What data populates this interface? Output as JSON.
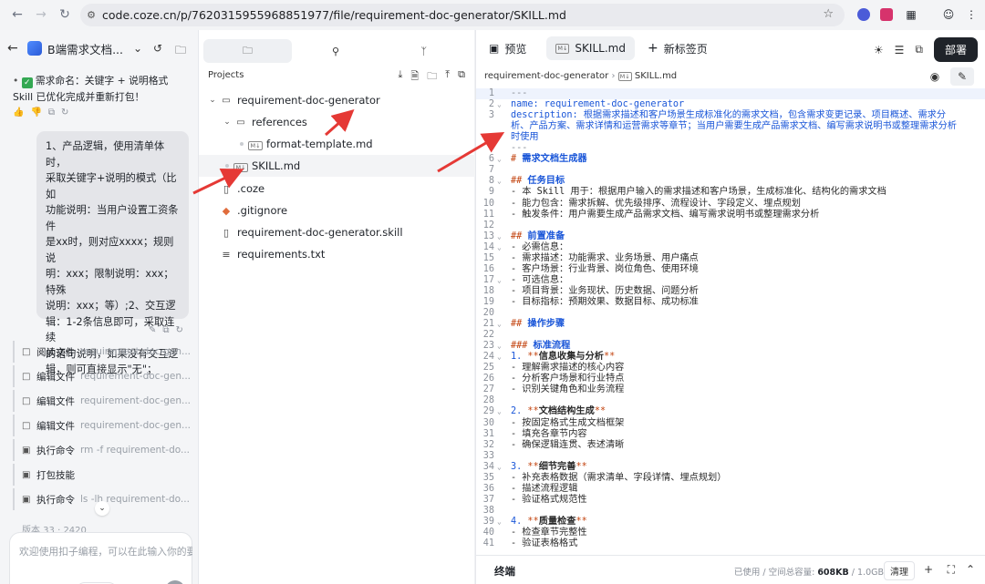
{
  "browser": {
    "url": "code.coze.cn/p/7620315955968851977/file/requirement-doc-generator/SKILL.md",
    "icons": [
      "back-icon",
      "forward-icon",
      "reload-icon",
      "site-info-icon",
      "star-icon",
      "extension-icon",
      "profile-icon",
      "menu-icon"
    ]
  },
  "chat": {
    "project_name": "B端需求文档...",
    "messages": {
      "line1": "需求命名：关键字 + 说明格式",
      "line2": "Skill 已优化完成并重新打包！"
    },
    "user_bubble": [
      "1、产品逻辑，使用清单体时，",
      "采取关键字+说明的模式（比如",
      "功能说明：当用户设置工资条件",
      "是xx时，则对应xxxx；规则说",
      "明：xxx；限制说明：xxx；特殊",
      "说明：xxx；等）;2、交互逻",
      "辑：1-2条信息即可，采取连续",
      "的语句说明，如果没有交互逻",
      "辑，则可直接显示\"无\"；"
    ],
    "tool_calls": [
      {
        "label": "阅读文件",
        "arg": "requirement-doc-gen...",
        "icon": "file-icon"
      },
      {
        "label": "编辑文件",
        "arg": "requirement-doc-gen...",
        "icon": "file-icon"
      },
      {
        "label": "编辑文件",
        "arg": "requirement-doc-gen...",
        "icon": "file-icon"
      },
      {
        "label": "编辑文件",
        "arg": "requirement-doc-gen...",
        "icon": "file-icon"
      },
      {
        "label": "执行命令",
        "arg": "rm -f requirement-do...",
        "icon": "terminal-icon"
      },
      {
        "label": "打包技能",
        "arg": "",
        "icon": "terminal-icon"
      },
      {
        "label": "执行命令",
        "arg": "ls -lh requirement-do...",
        "icon": "terminal-icon"
      }
    ],
    "peek_text": "版本 33 · 2420",
    "input_placeholder": "欢迎使用扣子编程，可以在此输入你的要求",
    "mode": "自动"
  },
  "tree": {
    "projects_label": "Projects",
    "nodes": [
      {
        "name": "requirement-doc-generator",
        "kind": "folder",
        "depth": 0,
        "expanded": true
      },
      {
        "name": "references",
        "kind": "folder",
        "depth": 1,
        "expanded": true
      },
      {
        "name": "format-template.md",
        "kind": "md",
        "depth": 2
      },
      {
        "name": "SKILL.md",
        "kind": "md",
        "depth": 1,
        "selected": true
      },
      {
        "name": ".coze",
        "kind": "file",
        "depth": 0
      },
      {
        "name": ".gitignore",
        "kind": "git",
        "depth": 0
      },
      {
        "name": "requirement-doc-generator.skill",
        "kind": "file",
        "depth": 0
      },
      {
        "name": "requirements.txt",
        "kind": "text",
        "depth": 0
      }
    ]
  },
  "editor": {
    "tabs": {
      "preview": "预览",
      "file": "SKILL.md",
      "new_tab": "新标签页"
    },
    "deploy": "部署",
    "breadcrumb": {
      "folder": "requirement-doc-generator",
      "file": "SKILL.md"
    },
    "lines": [
      {
        "n": "1",
        "t": "---",
        "c": "dash"
      },
      {
        "n": "2",
        "t": "name: requirement-doc-generator",
        "c": "blue",
        "fold": true
      },
      {
        "n": "3",
        "t": "description: 根据需求描述和客户场景生成标准化的需求文档，包含需求变更记录、项目概述、需求分",
        "c": "blue"
      },
      {
        "n": "",
        "t": "析、产品方案、需求详情和运营需求等章节；当用户需要生成产品需求文档、编写需求说明书或整理需求分析",
        "c": "blue"
      },
      {
        "n": "",
        "t": "时使用",
        "c": "blue"
      },
      {
        "n": "",
        "t": "---",
        "c": "dash"
      },
      {
        "n": "6",
        "t": "# 需求文档生成器",
        "c": "head",
        "fold": true
      },
      {
        "n": "7",
        "t": "",
        "c": ""
      },
      {
        "n": "8",
        "t": "## 任务目标",
        "c": "head",
        "fold": true
      },
      {
        "n": "9",
        "t": "- 本 Skill 用于：根据用户输入的需求描述和客户场景，生成标准化、结构化的需求文档",
        "c": ""
      },
      {
        "n": "10",
        "t": "- 能力包含：需求拆解、优先级排序、流程设计、字段定义、埋点规划",
        "c": ""
      },
      {
        "n": "11",
        "t": "- 触发条件：用户需要生成产品需求文档、编写需求说明书或整理需求分析",
        "c": ""
      },
      {
        "n": "12",
        "t": "",
        "c": ""
      },
      {
        "n": "13",
        "t": "## 前置准备",
        "c": "head",
        "fold": true
      },
      {
        "n": "14",
        "t": "- 必需信息：",
        "c": "",
        "fold": true
      },
      {
        "n": "15",
        "t": "  - 需求描述：功能需求、业务场景、用户痛点",
        "c": ""
      },
      {
        "n": "16",
        "t": "  - 客户场景：行业背景、岗位角色、使用环境",
        "c": ""
      },
      {
        "n": "17",
        "t": "- 可选信息：",
        "c": "",
        "fold": true
      },
      {
        "n": "18",
        "t": "  - 项目背景：业务现状、历史数据、问题分析",
        "c": ""
      },
      {
        "n": "19",
        "t": "  - 目标指标：预期效果、数据目标、成功标准",
        "c": ""
      },
      {
        "n": "20",
        "t": "",
        "c": ""
      },
      {
        "n": "21",
        "t": "## 操作步骤",
        "c": "head",
        "fold": true
      },
      {
        "n": "22",
        "t": "",
        "c": ""
      },
      {
        "n": "23",
        "t": "### 标准流程",
        "c": "head",
        "fold": true
      },
      {
        "n": "24",
        "t": "1. **信息收集与分析**",
        "c": "strong",
        "fold": true
      },
      {
        "n": "25",
        "t": "   - 理解需求描述的核心内容",
        "c": ""
      },
      {
        "n": "26",
        "t": "   - 分析客户场景和行业特点",
        "c": ""
      },
      {
        "n": "27",
        "t": "   - 识别关键角色和业务流程",
        "c": ""
      },
      {
        "n": "28",
        "t": "",
        "c": ""
      },
      {
        "n": "29",
        "t": "2. **文档结构生成**",
        "c": "strong",
        "fold": true
      },
      {
        "n": "30",
        "t": "   - 按固定格式生成文档框架",
        "c": ""
      },
      {
        "n": "31",
        "t": "   - 填充各章节内容",
        "c": ""
      },
      {
        "n": "32",
        "t": "   - 确保逻辑连贯、表述清晰",
        "c": ""
      },
      {
        "n": "33",
        "t": "",
        "c": ""
      },
      {
        "n": "34",
        "t": "3. **细节完善**",
        "c": "strong",
        "fold": true
      },
      {
        "n": "35",
        "t": "   - 补充表格数据（需求清单、字段详情、埋点规划）",
        "c": ""
      },
      {
        "n": "36",
        "t": "   - 描述流程逻辑",
        "c": ""
      },
      {
        "n": "37",
        "t": "   - 验证格式规范性",
        "c": ""
      },
      {
        "n": "38",
        "t": "",
        "c": ""
      },
      {
        "n": "39",
        "t": "4. **质量检查**",
        "c": "strong",
        "fold": true
      },
      {
        "n": "40",
        "t": "   - 检查章节完整性",
        "c": ""
      },
      {
        "n": "41",
        "t": "   - 验证表格格式",
        "c": ""
      }
    ],
    "terminal": {
      "title": "终端",
      "storage_label": "已使用 / 空间总容量:",
      "used": "608KB",
      "total": "/ 1.0GB",
      "clear": "清理"
    }
  },
  "colors": {
    "accent_blue": "#1a56d8",
    "arrow_red": "#e53935",
    "dark_button": "#1f2329"
  }
}
